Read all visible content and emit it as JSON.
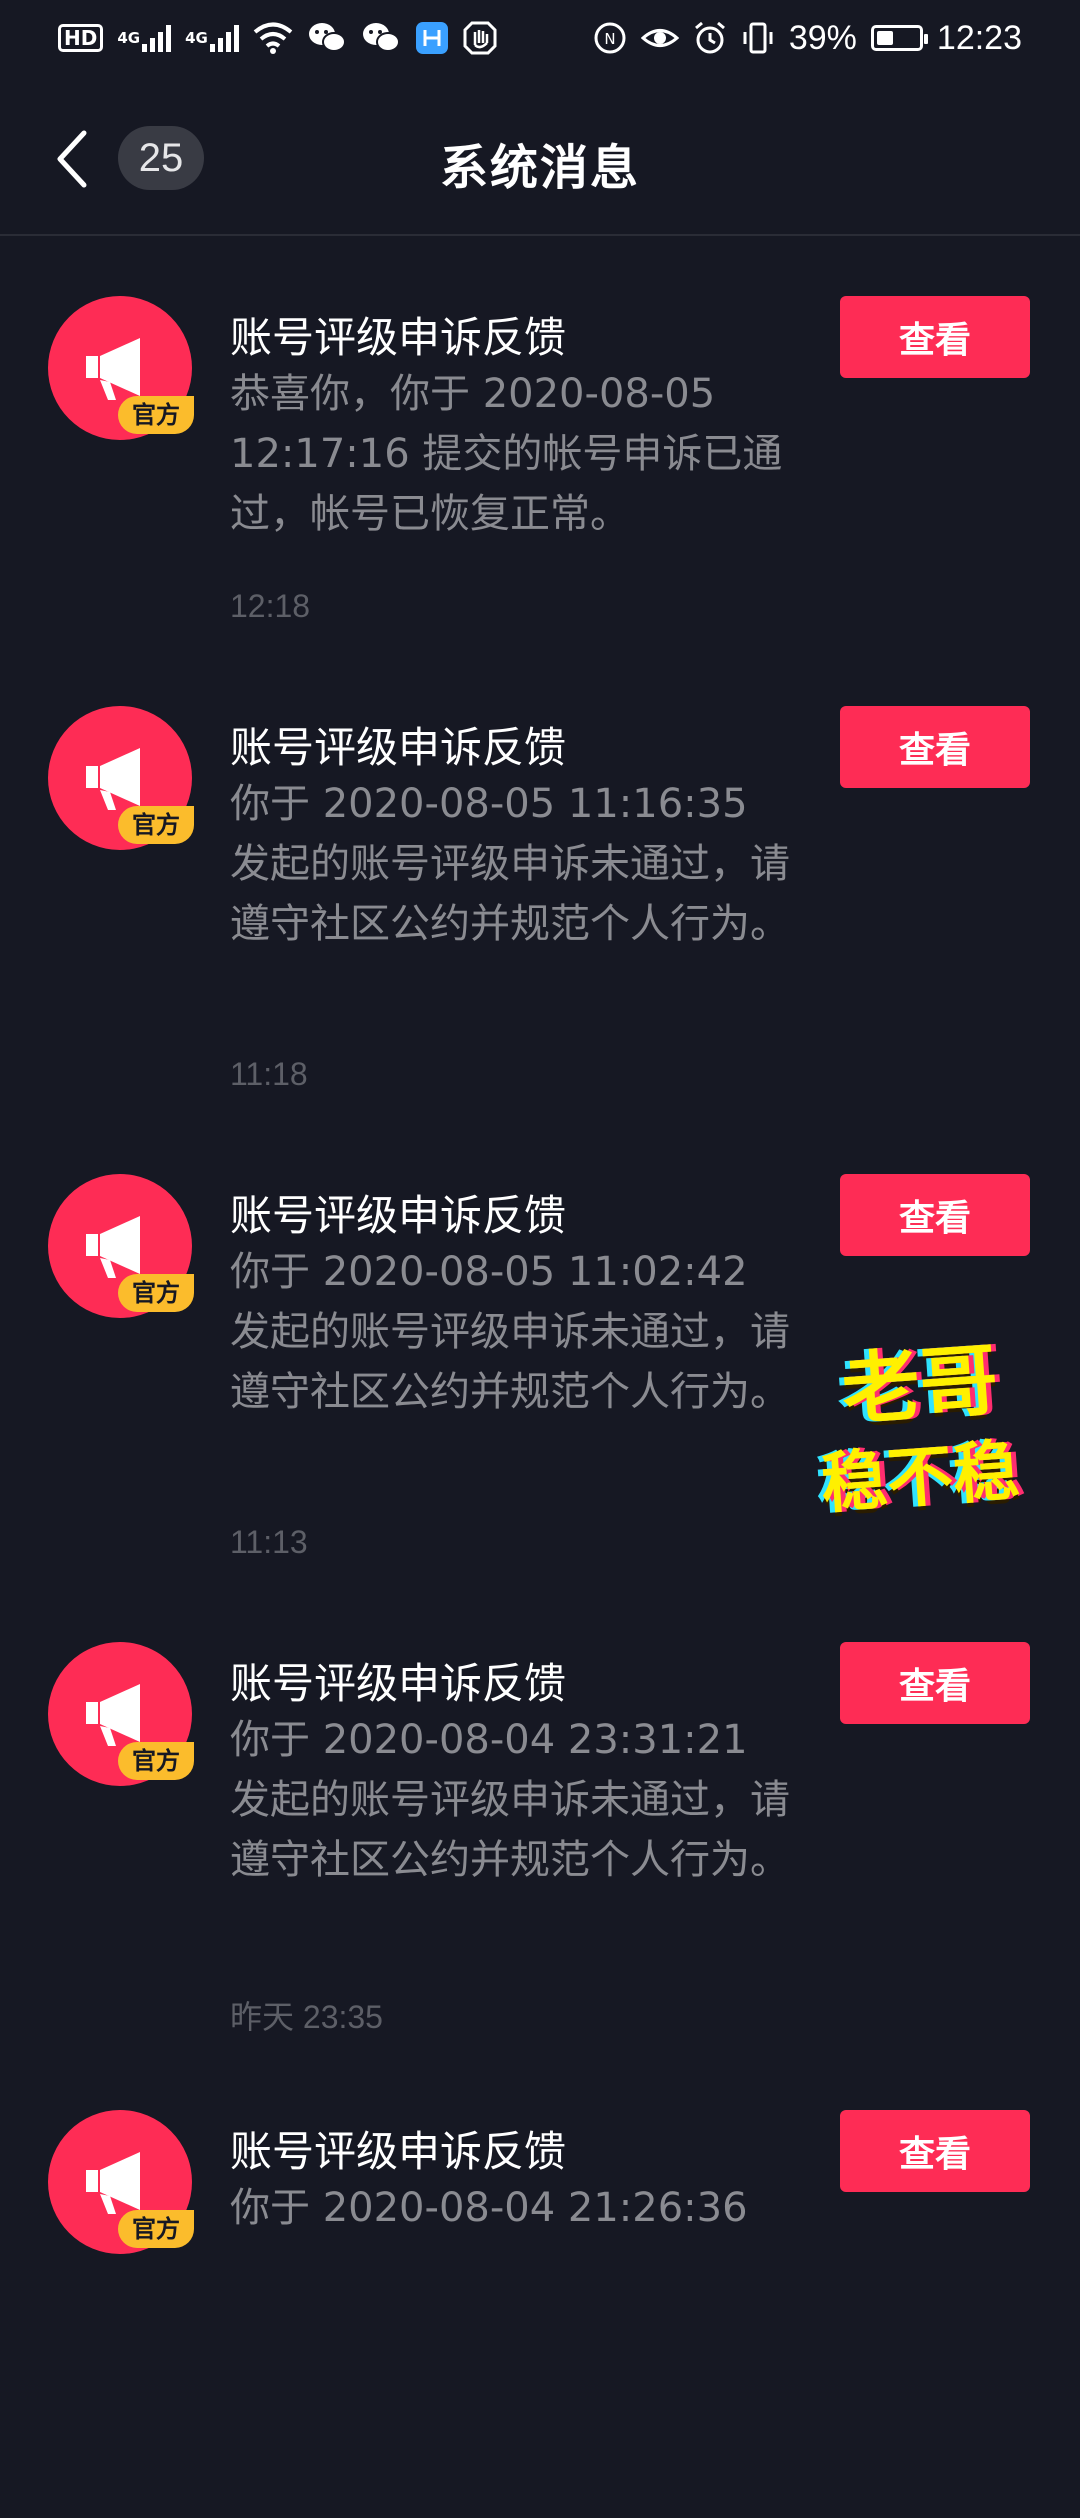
{
  "status_bar": {
    "hd_label": "HD",
    "sim1_label": "4G",
    "sim2_label": "4G",
    "battery_percent": "39%",
    "battery_level": 0.39,
    "time": "12:23",
    "icons": [
      "hd-icon",
      "signal-icon",
      "signal-icon",
      "wifi-icon",
      "wechat-icon",
      "wechat-icon",
      "app-icon",
      "hand-icon",
      "nfc-icon",
      "eye-icon",
      "alarm-icon",
      "vibrate-icon",
      "battery-icon"
    ]
  },
  "header": {
    "title": "系统消息",
    "unread_count": "25"
  },
  "messages": [
    {
      "title": "账号评级申诉反馈",
      "body": "恭喜你，你于 2020-08-05 12:17:16 提交的帐号申诉已通过，帐号已恢复正常。",
      "time": "12:18",
      "badge": "官方",
      "button": "查看"
    },
    {
      "title": "账号评级申诉反馈",
      "body": "你于 2020-08-05 11:16:35 发起的账号评级申诉未通过，请遵守社区公约并规范个人行为。",
      "time": "11:18",
      "badge": "官方",
      "button": "查看"
    },
    {
      "title": "账号评级申诉反馈",
      "body": "你于 2020-08-05 11:02:42 发起的账号评级申诉未通过，请遵守社区公约并规范个人行为。",
      "time": "11:13",
      "badge": "官方",
      "button": "查看"
    },
    {
      "title": "账号评级申诉反馈",
      "body": "你于 2020-08-04 23:31:21 发起的账号评级申诉未通过，请遵守社区公约并规范个人行为。",
      "time": "昨天 23:35",
      "badge": "官方",
      "button": "查看"
    },
    {
      "title": "账号评级申诉反馈",
      "body": "你于 2020-08-04 21:26:36",
      "time": "",
      "badge": "官方",
      "button": "查看"
    }
  ],
  "sticker": {
    "line1": "老哥",
    "line2": "稳不稳"
  },
  "colors": {
    "background": "#161823",
    "accent": "#fe2c55",
    "badge": "#fbbc2c",
    "body_text": "#8a8b91",
    "time_text": "#5d5f67"
  }
}
